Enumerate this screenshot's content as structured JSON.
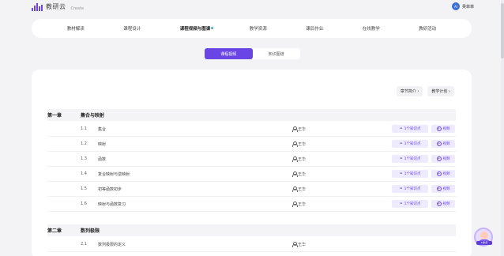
{
  "app": {
    "logo_text": "教研云",
    "logo_sub": "Create",
    "avatar_text": "AI",
    "user_name": "吴菲菲"
  },
  "nav": {
    "items": [
      "教材解读",
      "课程设计",
      "课程视频与图谱",
      "教学资源",
      "课后作业",
      "在线教学",
      "教研活动"
    ]
  },
  "segment": {
    "active": "课程视频",
    "inactive": "知识图谱"
  },
  "tools": {
    "chapter_intro": "章节简介 ›",
    "teaching_plan": "教学计划 ›"
  },
  "chapters": [
    {
      "num": "第一章",
      "title": "集合与映射",
      "rows": [
        {
          "num": "1.1",
          "title": "集合",
          "teacher": "王华",
          "kp": "1个知识点",
          "action": "视频"
        },
        {
          "num": "1.2",
          "title": "映射",
          "teacher": "王华",
          "kp": "1个知识点",
          "action": "视频"
        },
        {
          "num": "1.3",
          "title": "函数",
          "teacher": "王华",
          "kp": "1个知识点",
          "action": "视频"
        },
        {
          "num": "1.4",
          "title": "复合映射与逆映射",
          "teacher": "王华",
          "kp": "1个知识点",
          "action": "视频"
        },
        {
          "num": "1.5",
          "title": "初等函数初步",
          "teacher": "王华",
          "kp": "1个知识点",
          "action": "视频"
        },
        {
          "num": "1.6",
          "title": "映射与函数复习",
          "teacher": "王华",
          "kp": "1个知识点",
          "action": "视频"
        }
      ]
    },
    {
      "num": "第二章",
      "title": "数列极限",
      "rows": [
        {
          "num": "2.1",
          "title": "数列极限的定义",
          "teacher": "王华"
        }
      ]
    }
  ],
  "helper": {
    "label": "AI助手"
  },
  "colors": {
    "accent": "#6a45e6",
    "accent_light": "#eeeaff",
    "page_bg": "#f3f3f6"
  }
}
